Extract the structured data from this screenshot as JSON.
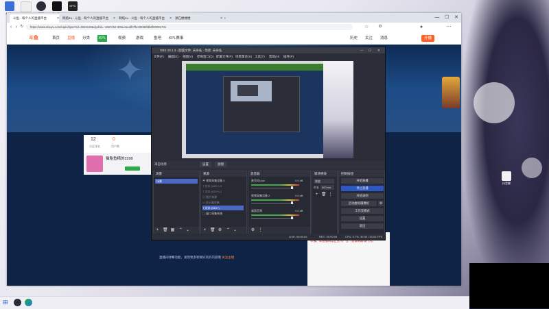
{
  "desktop": {
    "icons": [
      {
        "label": "Adobe",
        "color": "#3b6fd6"
      },
      {
        "label": "",
        "color": "#eeeeee"
      },
      {
        "label": "OBS",
        "color": "#2b2e38"
      },
      {
        "label": "CapCut",
        "color": "#111111"
      },
      {
        "label": "EPIC",
        "color": "#222222"
      }
    ],
    "right_icon_label": "抖音聊"
  },
  "browser": {
    "tabs": [
      {
        "title": "斗鱼 - 每个人的直播平台"
      },
      {
        "title": "网络4u - 斗鱼 - 每个人的直播平台"
      },
      {
        "title": "网络4u - 斗鱼 - 每个人的直播平台"
      },
      {
        "title": "源在楼楼楼"
      }
    ],
    "url": "https://www.douyu.com/topic/bjsa?rid=2815118&dyshid=-1557cb2-305ee5eafb7fbc09098fdb6f00091701",
    "window_controls": [
      "—",
      "☐",
      "✕"
    ]
  },
  "site": {
    "logo": "斗鱼",
    "nav": [
      "首页",
      "直播",
      "分类",
      "KPL",
      "视频",
      "游戏",
      "鱼吧",
      "KPL赛事"
    ],
    "header_right": [
      "历史",
      "关注",
      "消息",
      "开播"
    ],
    "stats": [
      "12",
      "0"
    ],
    "stat_labels": [
      "分区排名",
      "用户数"
    ],
    "streamer_name": "猫胎鱼精的2200",
    "bottom_text": "直播间弹幕功能，发现更多新鲜好玩的内容哦",
    "bottom_link": "关注主播",
    "side_text": "此直播间欢迎你，请遵守斗鱼直播规范，违法违规内容请举报。本直播间禁止宣传广告、恶意刷屏等行为。"
  },
  "obs": {
    "title": "OBS 29.1.3 - 配置文件: 未命名 - 场景: 未命名",
    "menu": [
      "文件(F)",
      "编辑(E)",
      "视图(V)",
      "停靠窗口(D)",
      "配置文件(P)",
      "场景集合(S)",
      "工具(T)",
      "帮助(H)",
      "插件(P)"
    ],
    "toolbar_label": "来自场景",
    "toolbar_buttons": [
      "设置",
      "滤镜"
    ],
    "docks": {
      "scenes": {
        "title": "场景",
        "items": [
          "场景"
        ]
      },
      "sources": {
        "title": "来源",
        "items": [
          "视频采集设备 3",
          "文本 (GDI+) 3",
          "文本 (GDI+) 2",
          "图片来源",
          "显示器采集",
          "文本 (GDI+)",
          "窗口采集系统"
        ]
      },
      "mixer": {
        "title": "混音器",
        "channels": [
          {
            "name": "麦克风/Aux",
            "db": "0.0 dB"
          },
          {
            "name": "视频采集设备 2",
            "db": "0.0 dB"
          },
          {
            "name": "桌面音频",
            "db": "0.0 dB"
          }
        ]
      },
      "transitions": {
        "title": "转场特效",
        "type": "渐变",
        "duration_label": "时长",
        "duration": "300 ms"
      },
      "controls": {
        "title": "控制按钮",
        "buttons": [
          "开始直播",
          "停止直播",
          "开始录制",
          "启动虚拟摄像机",
          "工作室模式",
          "设置",
          "退出"
        ]
      }
    },
    "status": {
      "live": "LIVE: 00:00:00",
      "rec": "REC: 00:00:00",
      "cpu": "CPU: 0.7%, 30.00 / 30.00 FPS"
    },
    "accent": "#2d57c2"
  }
}
